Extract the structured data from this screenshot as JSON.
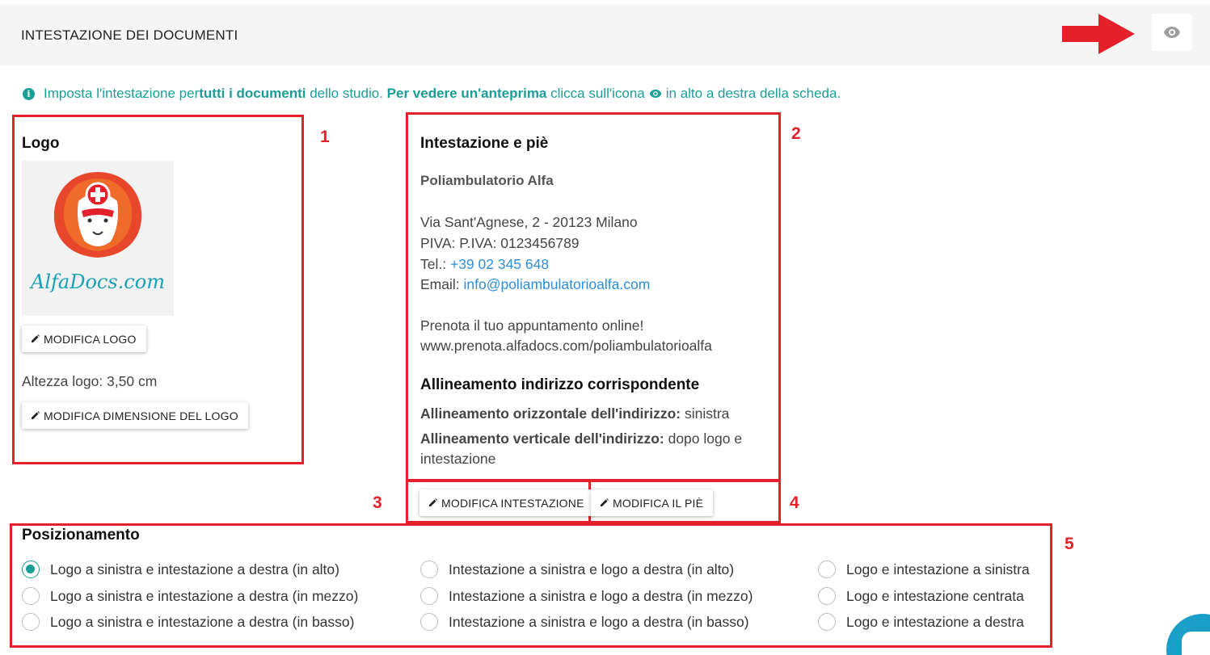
{
  "header": {
    "title": "INTESTAZIONE DEI DOCUMENTI",
    "preview_icon": "eye-icon"
  },
  "info": {
    "icon": "info-icon",
    "part1": "Imposta l'intestazione per ",
    "bold1": "tutti i documenti",
    "part2": " dello studio. ",
    "bold2": "Per vedere un'anteprima",
    "part3": " clicca sull'icona",
    "part4": "in alto a destra della scheda."
  },
  "annotations": {
    "n1": "1",
    "n2": "2",
    "n3": "3",
    "n4": "4",
    "n5": "5",
    "color": "#e4202a"
  },
  "logo_section": {
    "title": "Logo",
    "logo_text": "AlfaDocs.com",
    "edit_logo_label": "MODIFICA LOGO",
    "height_text": "Altezza logo: 3,50 cm",
    "edit_size_label": "MODIFICA DIMENSIONE DEL LOGO"
  },
  "header_footer": {
    "title": "Intestazione e piè",
    "name": "Poliambulatorio Alfa",
    "address": "Via Sant'Agnese, 2 - 20123 Milano",
    "piva": "PIVA: P.IVA: 0123456789",
    "tel_label": "Tel.: ",
    "tel": "+39 02 345 648",
    "email_label": "Email: ",
    "email": "info@poliambulatorioalfa.com",
    "booking_line1": "Prenota il tuo appuntamento online!",
    "booking_line2": "www.prenota.alfadocs.com/poliambulatorioalfa",
    "alignment_title": "Allineamento indirizzo corrispondente",
    "h_align_label": "Allineamento orizzontale dell'indirizzo:",
    "h_align_value": " sinistra",
    "v_align_label": "Allineamento verticale dell'indirizzo:",
    "v_align_value": " dopo logo e",
    "v_align_value2": "intestazione",
    "edit_header_label": "MODIFICA INTESTAZIONE",
    "edit_footer_label": "MODIFICA IL PIÈ"
  },
  "positioning": {
    "title": "Posizionamento",
    "options": [
      {
        "label": "Logo a sinistra e intestazione a destra (in alto)",
        "checked": true
      },
      {
        "label": "Logo a sinistra e intestazione a destra (in mezzo)",
        "checked": false
      },
      {
        "label": "Logo a sinistra e intestazione a destra (in basso)",
        "checked": false
      },
      {
        "label": "Intestazione a sinistra e logo a destra (in alto)",
        "checked": false
      },
      {
        "label": "Intestazione a sinistra e logo a destra (in mezzo)",
        "checked": false
      },
      {
        "label": "Intestazione a sinistra e logo a destra (in basso)",
        "checked": false
      },
      {
        "label": "Logo e intestazione a sinistra",
        "checked": false
      },
      {
        "label": "Logo e intestazione centrata",
        "checked": false
      },
      {
        "label": "Logo e intestazione a destra",
        "checked": false
      }
    ]
  },
  "colors": {
    "accent": "#1a9e96",
    "link": "#2d8fd8",
    "annotation_red": "#e4202a"
  }
}
